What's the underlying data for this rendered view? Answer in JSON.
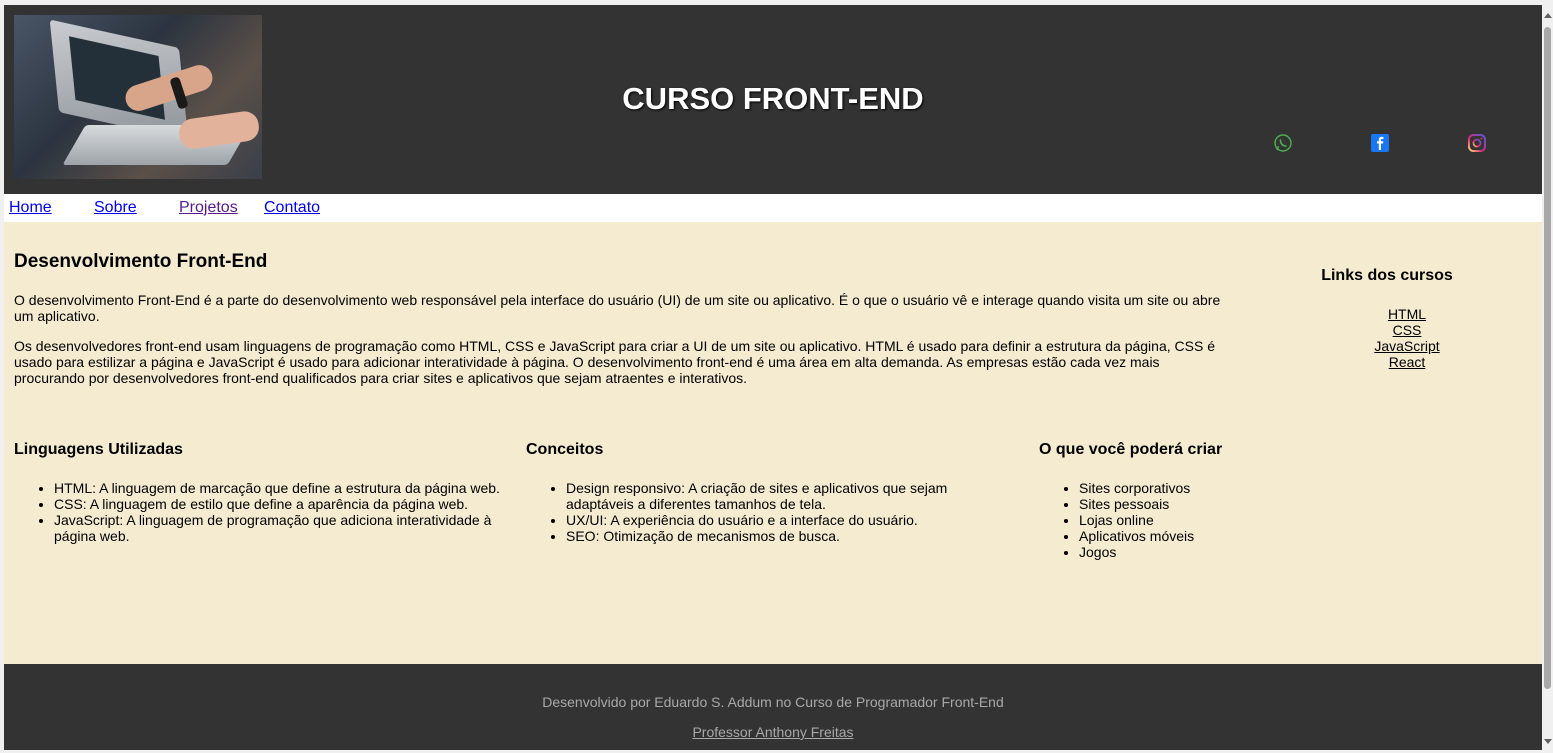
{
  "header": {
    "title": "CURSO FRONT-END",
    "social": [
      {
        "name": "whatsapp-icon",
        "color": "#4caf50"
      },
      {
        "name": "facebook-icon",
        "color": "#1877f2"
      },
      {
        "name": "instagram-icon",
        "color": "#e1306c"
      }
    ]
  },
  "nav": {
    "items": [
      "Home",
      "Sobre",
      "Projetos",
      "Contato"
    ]
  },
  "main": {
    "heading": "Desenvolvimento Front-End",
    "paragraph1": "O desenvolvimento Front-End é a parte do desenvolvimento web responsável pela interface do usuário (UI) de um site ou aplicativo. É o que o usuário vê e interage quando visita um site ou abre um aplicativo.",
    "paragraph2": "Os desenvolvedores front-end usam linguagens de programação como HTML, CSS e JavaScript para criar a UI de um site ou aplicativo. HTML é usado para definir a estrutura da página, CSS é usado para estilizar a página e JavaScript é usado para adicionar interatividade à página. O desenvolvimento front-end é uma área em alta demanda. As empresas estão cada vez mais procurando por desenvolvedores front-end qualificados para criar sites e aplicativos que sejam atraentes e interativos."
  },
  "columns": [
    {
      "title": "Linguagens Utilizadas",
      "items": [
        "HTML: A linguagem de marcação que define a estrutura da página web.",
        "CSS: A linguagem de estilo que define a aparência da página web.",
        "JavaScript: A linguagem de programação que adiciona interatividade à página web."
      ]
    },
    {
      "title": "Conceitos",
      "items": [
        "Design responsivo: A criação de sites e aplicativos que sejam adaptáveis a diferentes tamanhos de tela.",
        "UX/UI: A experiência do usuário e a interface do usuário.",
        "SEO: Otimização de mecanismos de busca."
      ]
    },
    {
      "title": "O que você poderá criar",
      "items": [
        "Sites corporativos",
        "Sites pessoais",
        "Lojas online",
        "Aplicativos móveis",
        "Jogos"
      ]
    }
  ],
  "aside": {
    "title": "Links dos cursos",
    "links": [
      "HTML",
      "CSS",
      "JavaScript",
      "React"
    ]
  },
  "footer": {
    "credit": "Desenvolvido por Eduardo S. Addum no Curso de Programador Front-End",
    "professor": "Professor Anthony Freitas"
  }
}
